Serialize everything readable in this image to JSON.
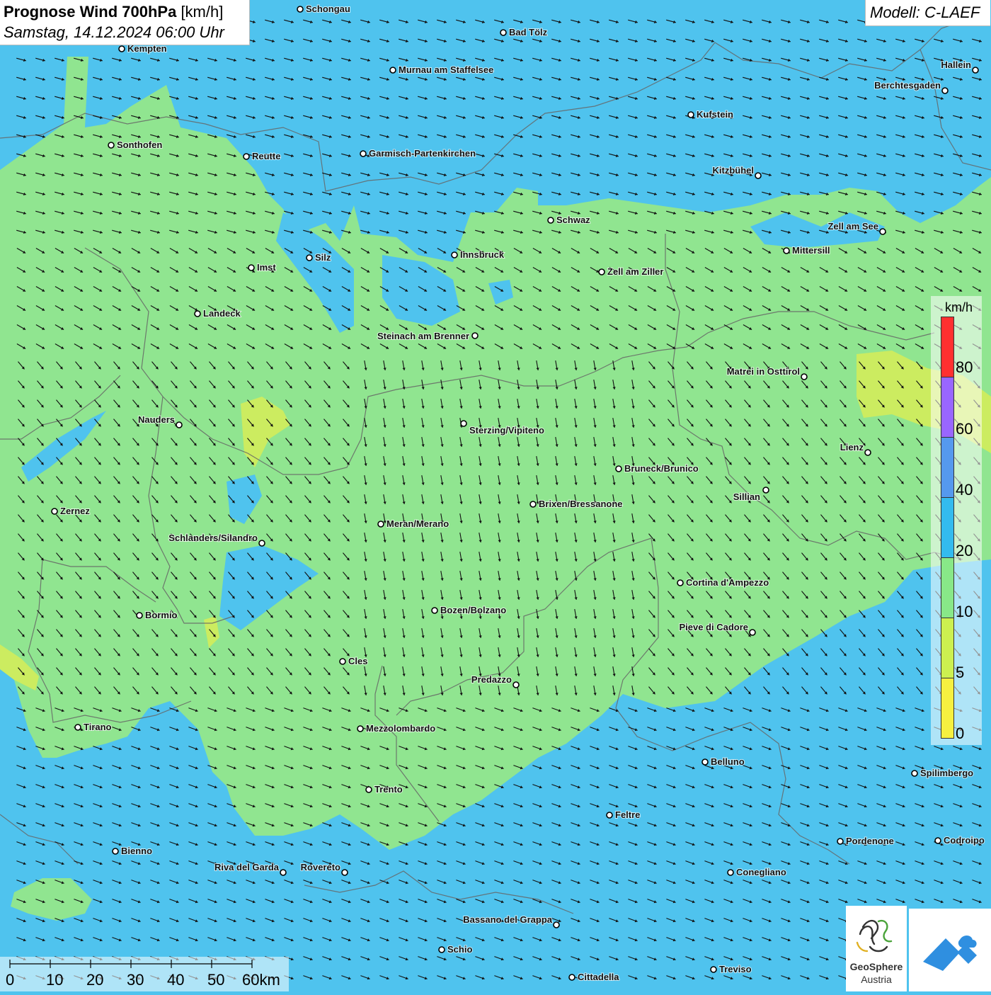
{
  "title": {
    "product": "Prognose Wind 700hPa",
    "unit": "[km/h]",
    "datetime": "Samstag, 14.12.2024 06:00 Uhr"
  },
  "model": "Modell: C-LAEF",
  "legend": {
    "unit": "km/h",
    "ticks": [
      "80",
      "60",
      "40",
      "20",
      "10",
      "5",
      "0"
    ],
    "colors": [
      "#ff3030",
      "#9966ff",
      "#5599ee",
      "#33bbee",
      "#88e888",
      "#ccf050",
      "#f6f040"
    ]
  },
  "scale_bar": {
    "labels": [
      "0",
      "10",
      "20",
      "30",
      "40",
      "50",
      "60km"
    ]
  },
  "logo": {
    "name": "GeoSphere",
    "country": "Austria"
  },
  "colors": {
    "blue_zone": "#4fc3ee",
    "green_zone": "#90e590",
    "yellow_zone": "#ccec60",
    "border": "#666666"
  },
  "cities": [
    {
      "name": "Schongau"
    },
    {
      "name": "Bad Tölz"
    },
    {
      "name": "Kempten"
    },
    {
      "name": "Murnau am Staffelsee"
    },
    {
      "name": "Hallein"
    },
    {
      "name": "Berchtesgaden"
    },
    {
      "name": "Kufstein"
    },
    {
      "name": "Sonthofen"
    },
    {
      "name": "Reutte"
    },
    {
      "name": "Garmisch-Partenkirchen"
    },
    {
      "name": "Kitzbühel"
    },
    {
      "name": "Schwaz"
    },
    {
      "name": "Zell am See"
    },
    {
      "name": "Mittersill"
    },
    {
      "name": "Innsbruck"
    },
    {
      "name": "Silz"
    },
    {
      "name": "Imst"
    },
    {
      "name": "Zell am Ziller"
    },
    {
      "name": "Landeck"
    },
    {
      "name": "Steinach am Brenner"
    },
    {
      "name": "Matrei in Osttirol"
    },
    {
      "name": "Nauders"
    },
    {
      "name": "Sterzing/Vipiteno"
    },
    {
      "name": "Lienz"
    },
    {
      "name": "Bruneck/Brunico"
    },
    {
      "name": "Sillian"
    },
    {
      "name": "Zernez"
    },
    {
      "name": "Brixen/Bressanone"
    },
    {
      "name": "Meran/Merano"
    },
    {
      "name": "Schlanders/Silandro"
    },
    {
      "name": "Cortina d'Ampezzo"
    },
    {
      "name": "Bozen/Bolzano"
    },
    {
      "name": "Bormio"
    },
    {
      "name": "Pieve di Cadore"
    },
    {
      "name": "Cles"
    },
    {
      "name": "Predazzo"
    },
    {
      "name": "Tirano"
    },
    {
      "name": "Mezzolombardo"
    },
    {
      "name": "Belluno"
    },
    {
      "name": "Spilimbergo"
    },
    {
      "name": "Trento"
    },
    {
      "name": "Feltre"
    },
    {
      "name": "Bienno"
    },
    {
      "name": "Pordenone"
    },
    {
      "name": "Codroipo"
    },
    {
      "name": "Riva del Garda"
    },
    {
      "name": "Rovereto"
    },
    {
      "name": "Conegliano"
    },
    {
      "name": "Bassano del Grappa"
    },
    {
      "name": "Schio"
    },
    {
      "name": "Treviso"
    },
    {
      "name": "Cittadella"
    }
  ]
}
